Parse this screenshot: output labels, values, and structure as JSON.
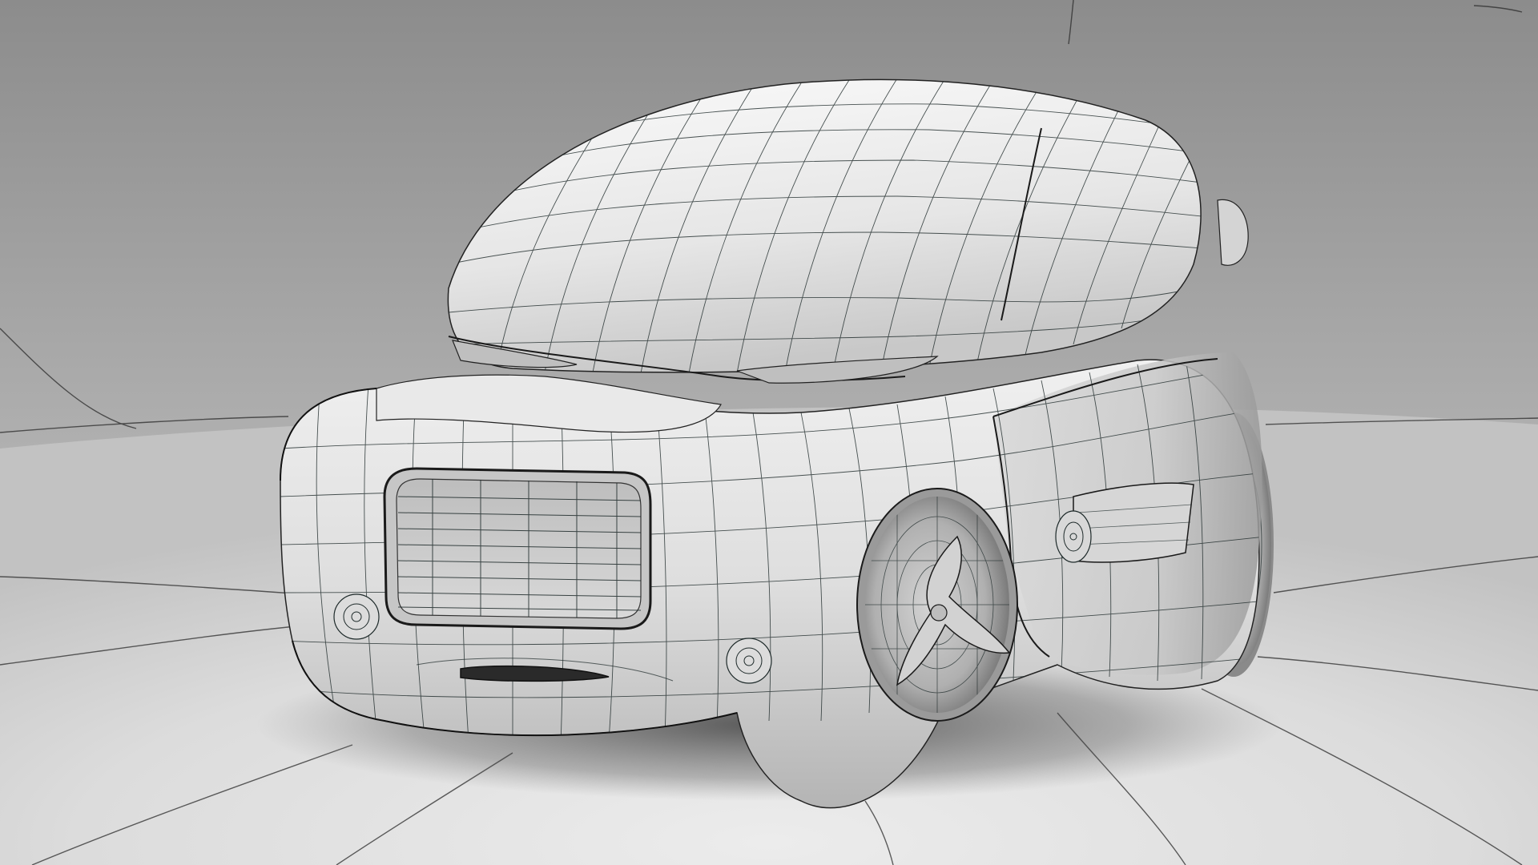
{
  "scene": {
    "subject": "wireframe-concept-car",
    "colors": {
      "backdrop_top": "#8e8e8e",
      "backdrop_bottom": "#c4c4c4",
      "floor_near": "#e6e6e6",
      "floor_far": "#cfcfcf",
      "body_light": "#f2f2f2",
      "body_mid": "#d9d9d9",
      "body_dark": "#a8a8a8",
      "wire": "#1e2a2a",
      "shadow": "#3a3a3a"
    }
  }
}
